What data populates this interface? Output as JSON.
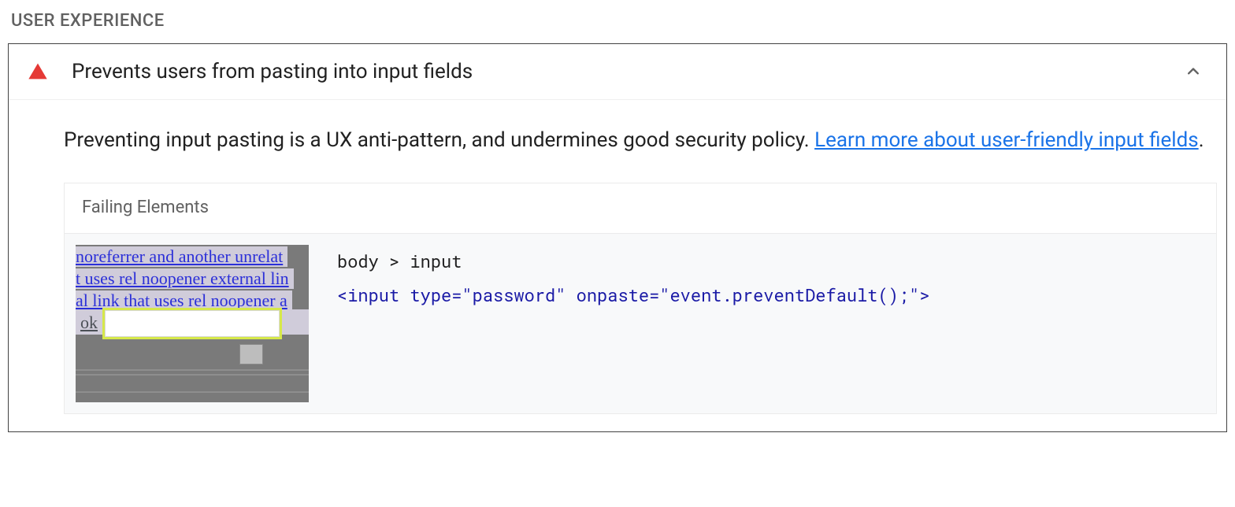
{
  "section": {
    "title": "USER EXPERIENCE"
  },
  "audit": {
    "title": "Prevents users from pasting into input fields",
    "description_text": "Preventing input pasting is a UX anti-pattern, and undermines good security policy. ",
    "link_text": "Learn more about user-friendly input fields",
    "failing": {
      "header": "Failing Elements",
      "thumb_lines": {
        "l1": " noreferrer and another unrelat",
        "l2": "t uses rel noopener external lin",
        "l3": "al link that uses rel noopener a",
        "ok": "ok"
      },
      "selector": "body > input",
      "snippet": "<input type=\"password\" onpaste=\"event.preventDefault();\">"
    }
  }
}
